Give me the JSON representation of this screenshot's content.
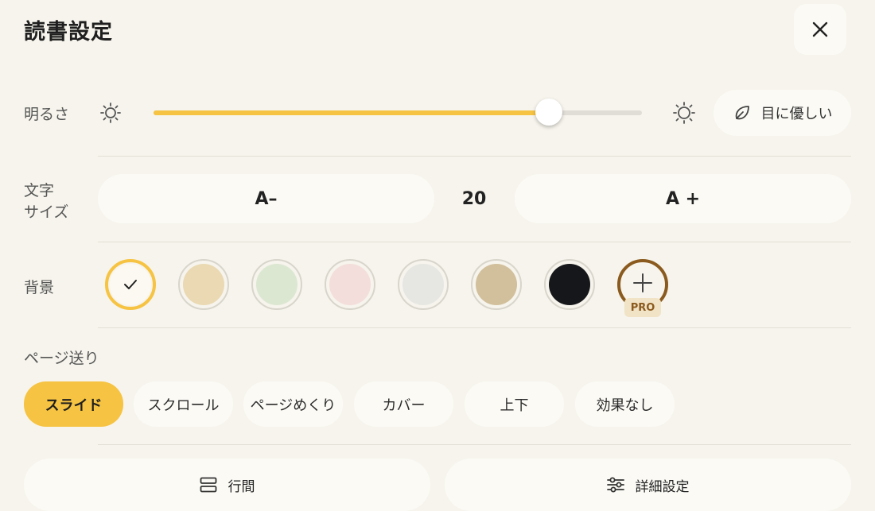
{
  "title": "読書設定",
  "close_icon": "close-icon",
  "brightness": {
    "label": "明るさ",
    "value_fraction": 0.81,
    "eco_label": "目に優しい",
    "eco_icon": "leaf-icon",
    "accent_color": "#f6c342"
  },
  "font_size": {
    "label_line1": "文字",
    "label_line2": "サイズ",
    "decrease_label": "A–",
    "increase_label": "A +",
    "value": "20"
  },
  "background": {
    "label": "背景",
    "swatches": [
      {
        "color": "#fbf9f1",
        "selected": true
      },
      {
        "color": "#ead9b2"
      },
      {
        "color": "#dce7d2"
      },
      {
        "color": "#f3dedb"
      },
      {
        "color": "#e6e6e3"
      },
      {
        "color": "#d2bf9c"
      },
      {
        "color": "#15171a"
      }
    ],
    "pro_badge": "PRO"
  },
  "page_turn": {
    "label": "ページ送り",
    "modes": [
      "スライド",
      "スクロール",
      "ページめくり",
      "カバー",
      "上下",
      "効果なし"
    ],
    "active_index": 0
  },
  "bottom": {
    "line_spacing_label": "行間",
    "advanced_label": "詳細設定"
  }
}
